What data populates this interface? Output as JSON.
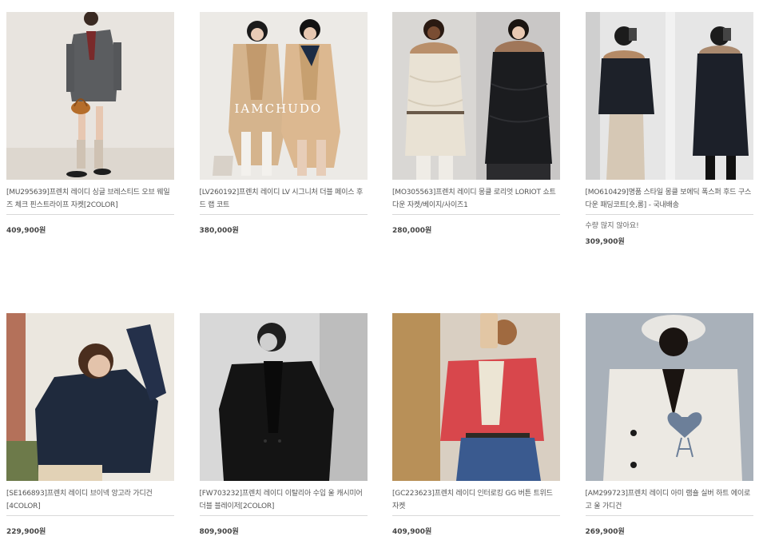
{
  "products": [
    {
      "title": "[MU295639]프렌치 레이디 싱글 브레스티드 오브 웨일즈 체크 핀스트라이프 자켓[2COLOR]",
      "price": "409,900원",
      "image": "model in grey blazer with brown bag"
    },
    {
      "title": "[LV260192]프렌치 레이디 LV 시그니처 더블 페이스 후드 랩 코트",
      "price": "380,000원",
      "image": "two models in beige wrap coats",
      "brand_text": "IAMCHUDO"
    },
    {
      "title": "[MO305563]프렌치 레이디 몽클 로리엇 LORIOT 쇼트 다운 자켓/베이지/사이즈1",
      "price": "280,000원",
      "image": "two models in fur hood down jackets"
    },
    {
      "title": "[MO610429]명품 스타일 몽클 보에딕 폭스퍼 후드 구스다운 패딩코트[숏,롱] - 국내배송",
      "note": "수량 많지 않아요!",
      "price": "309,900원",
      "image": "two models in black padded coats"
    },
    {
      "title": "[SE166893]프렌치 레이디 브이넥 앙고라 가디건[4COLOR]",
      "price": "229,900원",
      "image": "model in navy angora cardigan"
    },
    {
      "title": "[FW703232]프렌치 레이디 이탈리아 수입 울 캐시미어 더블 블레이저[2COLOR]",
      "price": "809,900원",
      "image": "model in black double blazer"
    },
    {
      "title": "[GC223623]프렌치 레이디 인터로킹 GG 버튼 트위드 자켓",
      "price": "409,900원",
      "image": "model in red tweed jacket"
    },
    {
      "title": "[AM299723]프렌치 레이디 아미 램숄 실버 하트 에이로고 울 가디건",
      "price": "269,900원",
      "image": "model in white cardigan with heart logo"
    }
  ]
}
